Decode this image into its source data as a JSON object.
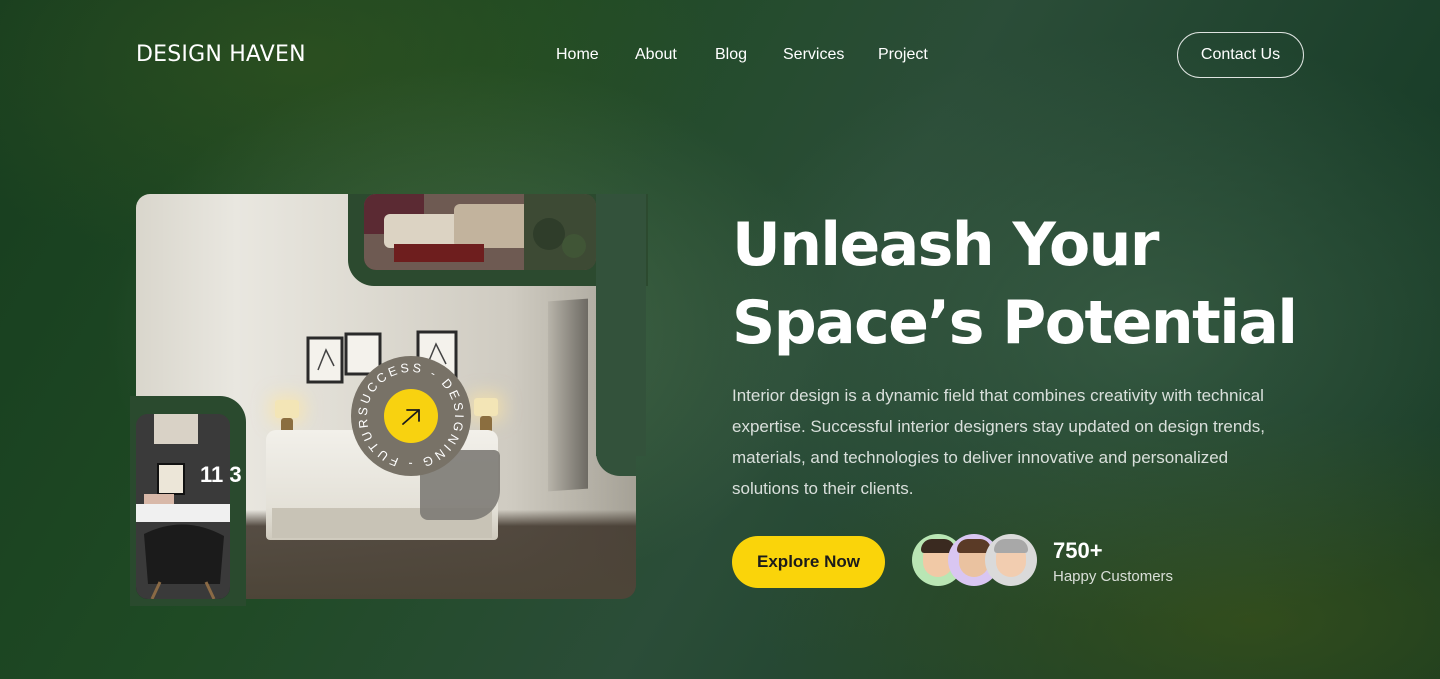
{
  "brand": {
    "logo": "DESIGN HAVEN"
  },
  "nav": {
    "items": [
      {
        "label": "Home"
      },
      {
        "label": "About"
      },
      {
        "label": "Blog"
      },
      {
        "label": "Services"
      },
      {
        "label": "Project"
      }
    ],
    "contact_label": "Contact Us"
  },
  "gallery": {
    "office_clock_text": "11 3",
    "badge_text": "SUCCESS - DESIGNING - FUTURE -",
    "badge_icon": "arrow-up-right-icon",
    "badge_color": "#f8d210"
  },
  "hero": {
    "title_line1": "Unleash Your",
    "title_line2": "Space’s Potential",
    "description": "Interior design is a dynamic field that combines creativity with technical expertise. Successful interior designers stay updated on design trends, materials, and technologies to deliver innovative and personalized solutions to their clients.",
    "cta_label": "Explore Now",
    "cta_color": "#fad40a"
  },
  "social_proof": {
    "count": "750+",
    "label": "Happy Customers",
    "avatar_colors": [
      "#b9e6b4",
      "#d9c6f2",
      "#dadada"
    ]
  }
}
